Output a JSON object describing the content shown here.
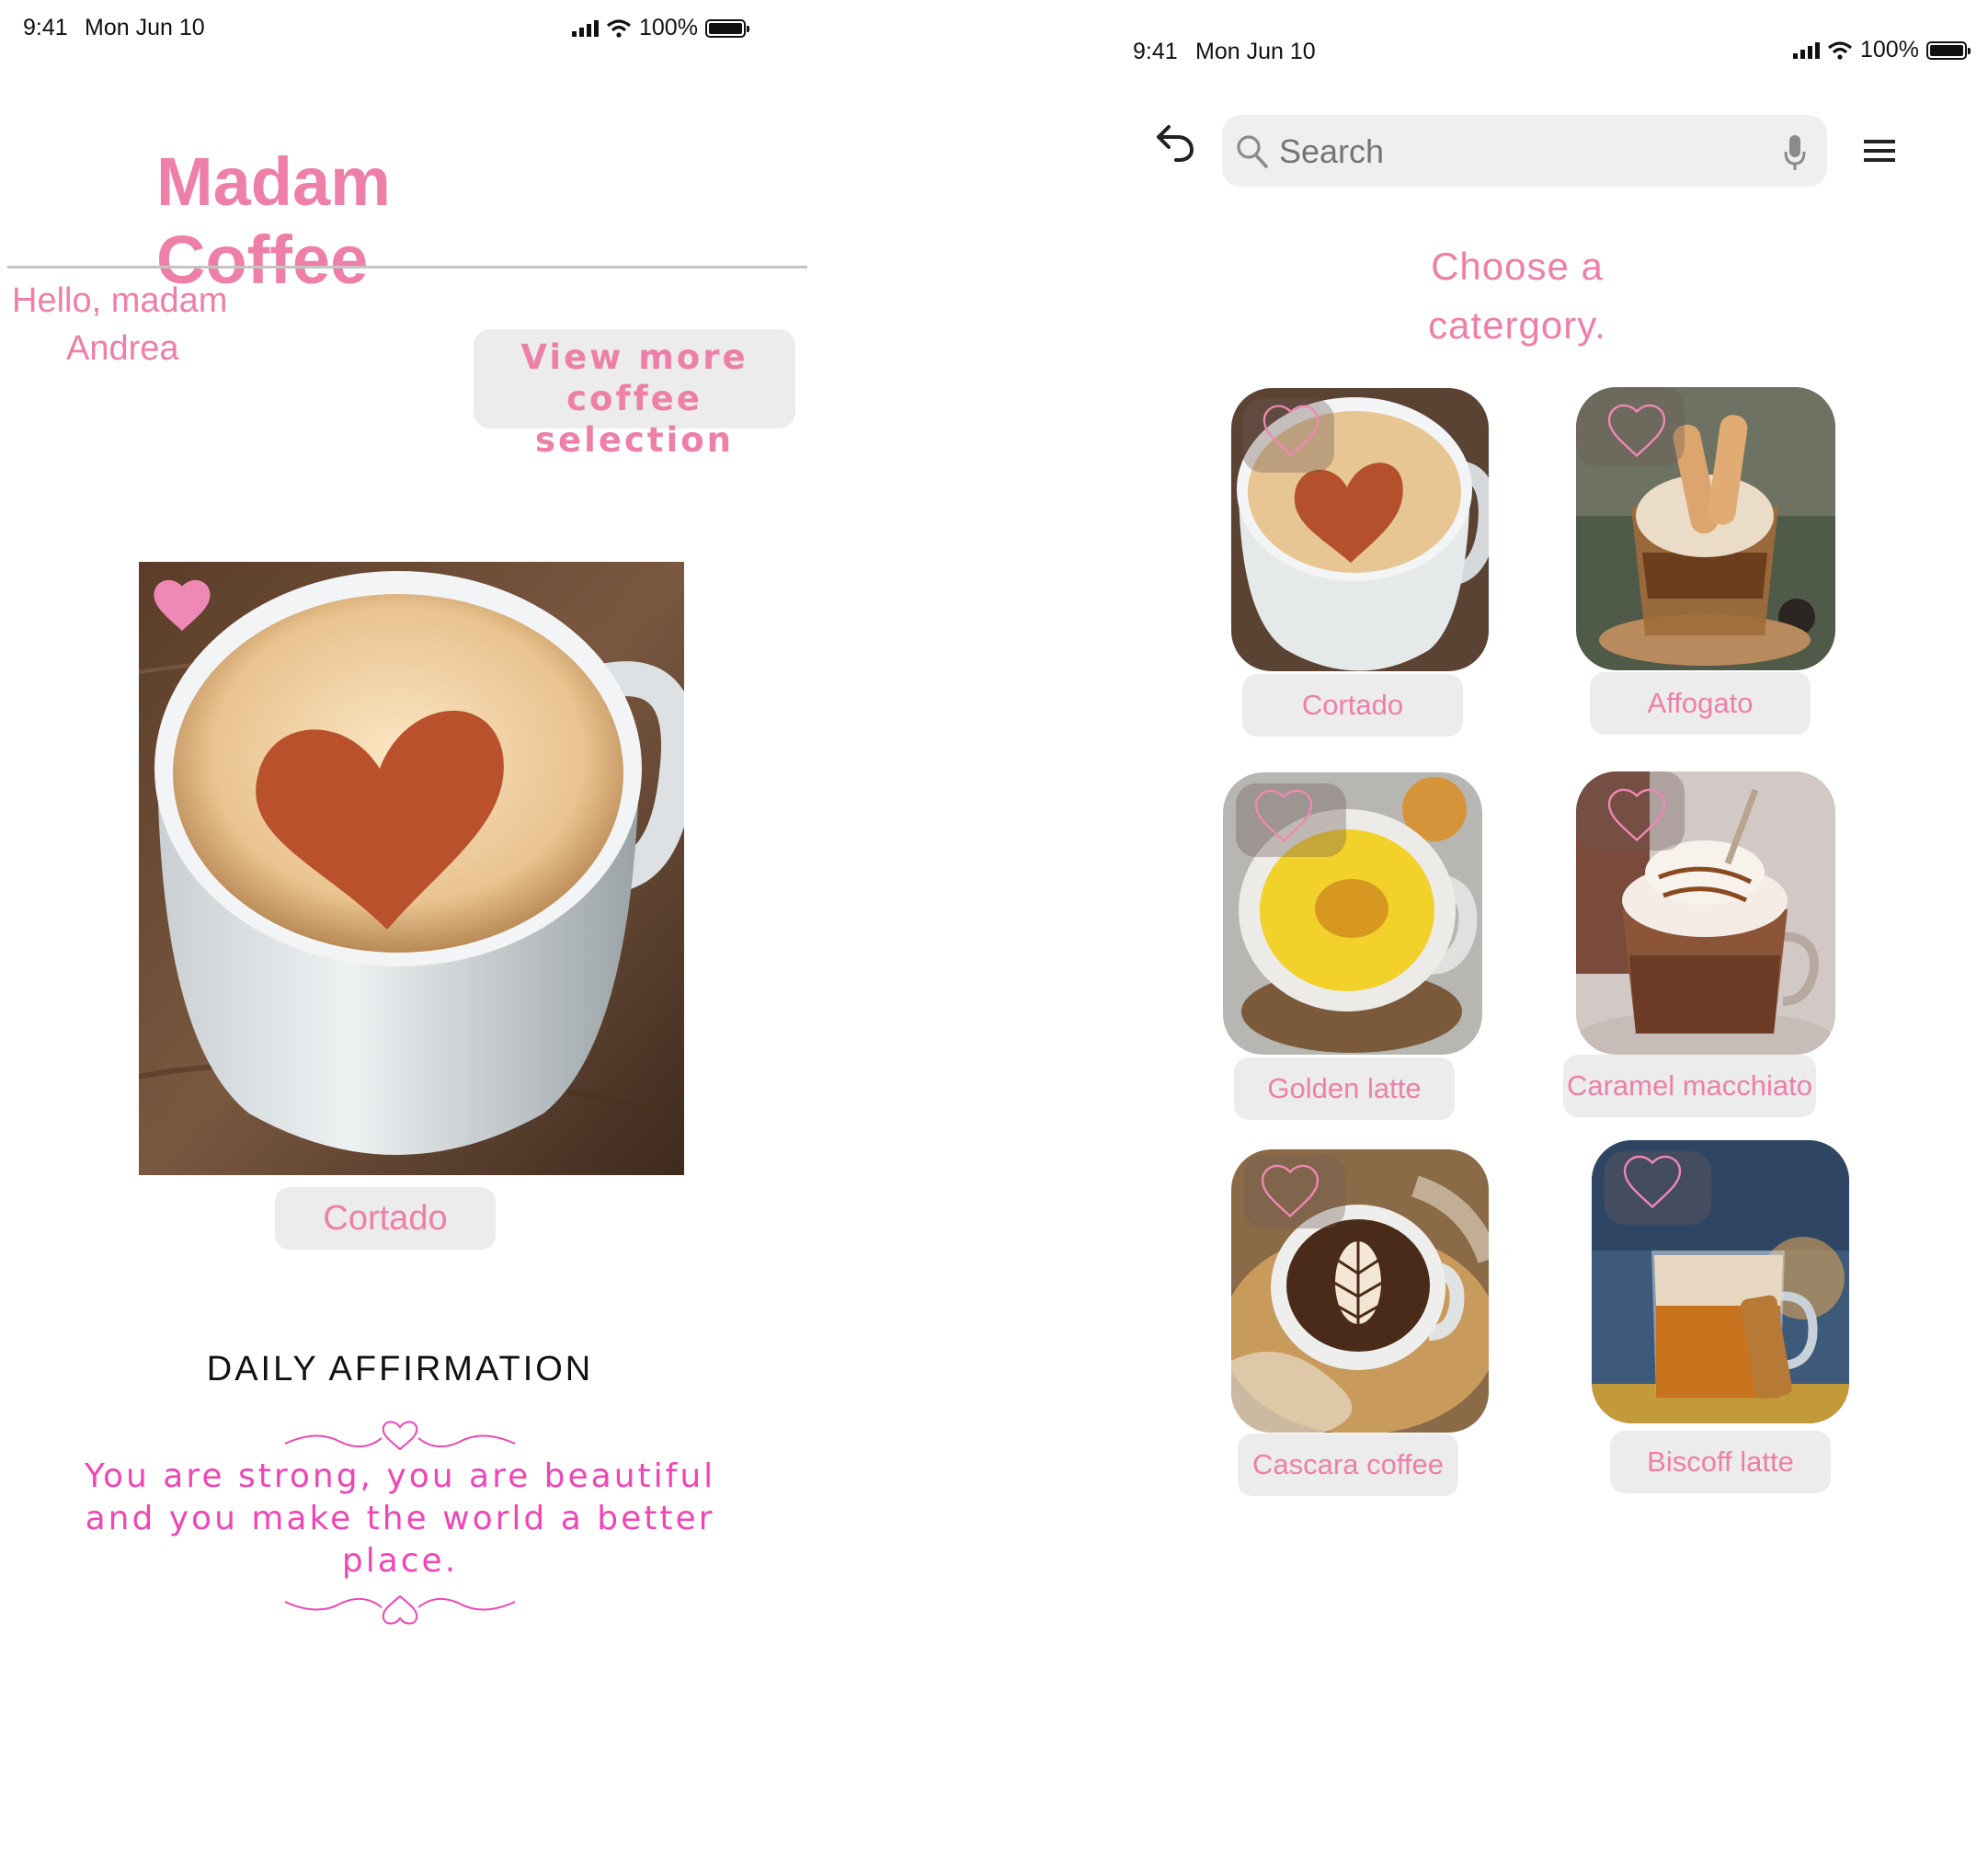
{
  "left_screen": {
    "status_bar": {
      "time": "9:41",
      "date": "Mon Jun 10",
      "battery": "100%"
    },
    "app_title": "Madam Coffee",
    "greeting_line1": "Hello, madam",
    "greeting_line2": "Andrea",
    "view_more_line1": "View more",
    "view_more_line2": "coffee selection",
    "featured": {
      "label": "Cortado",
      "favorited": true
    },
    "affirmation": {
      "heading": "DAILY AFFIRMATION",
      "line1": "You are strong, you are beautiful",
      "line2": "and you make the world a better",
      "line3": "place."
    }
  },
  "right_screen": {
    "status_bar": {
      "time": "9:41",
      "date": "Mon Jun 10",
      "battery": "100%"
    },
    "search": {
      "placeholder": "Search"
    },
    "heading_line1": "Choose a",
    "heading_line2": "catergory.",
    "categories": [
      {
        "label": "Cortado"
      },
      {
        "label": "Affogato"
      },
      {
        "label": "Golden latte"
      },
      {
        "label": "Caramel macchiato"
      },
      {
        "label": "Cascara coffee"
      },
      {
        "label": "Biscoff latte"
      }
    ]
  },
  "colors": {
    "accent_pink": "#ee7fa8",
    "affirmation_pink": "#ef46b4",
    "chip_gray": "#ececec"
  }
}
